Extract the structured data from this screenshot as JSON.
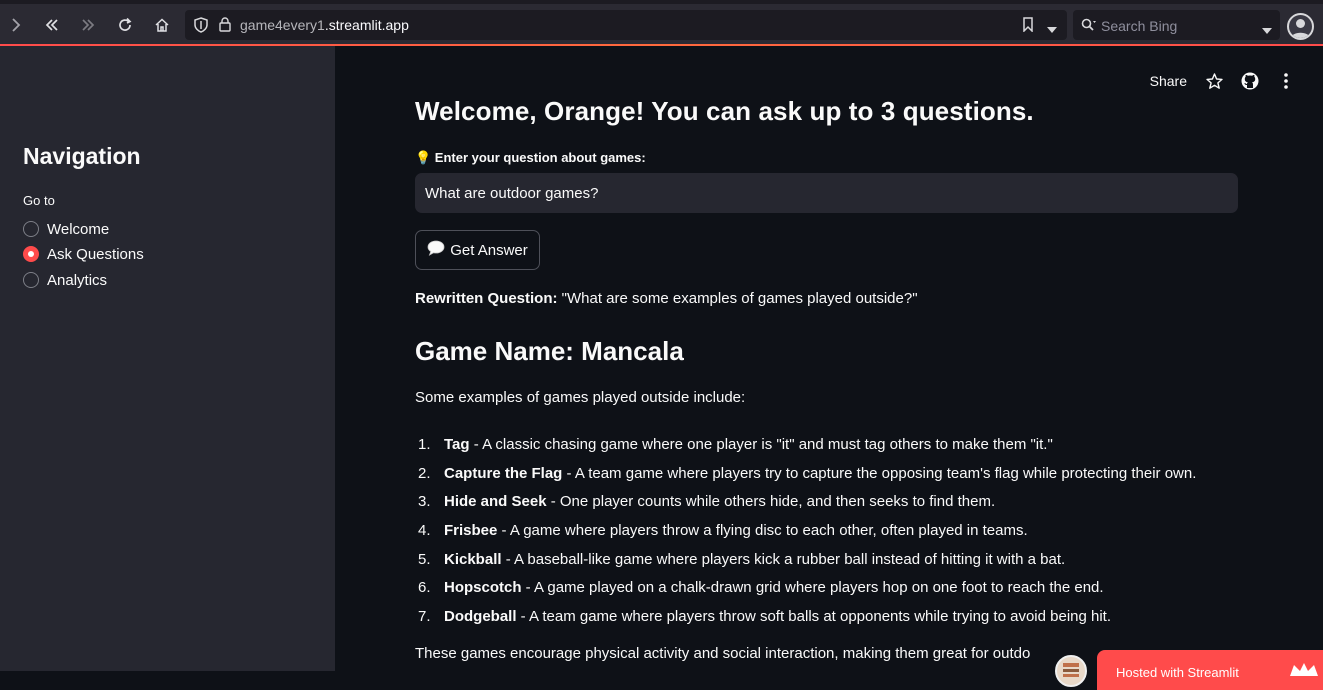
{
  "browser": {
    "url_prefix": "game4every1",
    "url_domain": ".streamlit.app",
    "search_placeholder": "Search Bing",
    "icons": [
      "chevron-right-icon",
      "back-icon",
      "forward-icon",
      "reload-icon",
      "home-icon",
      "shield-icon",
      "lock-icon",
      "bookmark-icon",
      "dropdown-icon",
      "search-icon",
      "profile-icon"
    ]
  },
  "sidebar": {
    "title": "Navigation",
    "group_label": "Go to",
    "options": [
      {
        "label": "Welcome",
        "selected": false
      },
      {
        "label": "Ask Questions",
        "selected": true
      },
      {
        "label": "Analytics",
        "selected": false
      }
    ]
  },
  "toolbar": {
    "share_label": "Share"
  },
  "main": {
    "heading": "Welcome, Orange! You can ask up to 3 questions.",
    "question_label": "💡 Enter your question about games:",
    "question_value": "What are outdoor games?",
    "button_icon": "🗨️",
    "button_label": "Get Answer",
    "rewritten_label": "Rewritten Question:",
    "rewritten_text": " \"What are some examples of games played outside?\"",
    "game_heading": "Game Name: Mancala",
    "intro": "Some examples of games played outside include:",
    "games": [
      {
        "num": "1.",
        "name": "Tag",
        "desc": " - A classic chasing game where one player is \"it\" and must tag others to make them \"it.\""
      },
      {
        "num": "2.",
        "name": "Capture the Flag",
        "desc": " - A team game where players try to capture the opposing team's flag while protecting their own."
      },
      {
        "num": "3.",
        "name": "Hide and Seek",
        "desc": " - One player counts while others hide, and then seeks to find them."
      },
      {
        "num": "4.",
        "name": "Frisbee",
        "desc": " - A game where players throw a flying disc to each other, often played in teams."
      },
      {
        "num": "5.",
        "name": "Kickball",
        "desc": " - A baseball-like game where players kick a rubber ball instead of hitting it with a bat."
      },
      {
        "num": "6.",
        "name": "Hopscotch",
        "desc": " - A game played on a chalk-drawn grid where players hop on one foot to reach the end."
      },
      {
        "num": "7.",
        "name": "Dodgeball",
        "desc": " - A team game where players throw soft balls at opponents while trying to avoid being hit."
      }
    ],
    "outro": "These games encourage physical activity and social interaction, making them great for outdo"
  },
  "badge": {
    "label": "Hosted with Streamlit"
  },
  "colors": {
    "accent": "#ff4b4b",
    "sidebar_bg": "#262730",
    "main_bg": "#0e1117"
  }
}
